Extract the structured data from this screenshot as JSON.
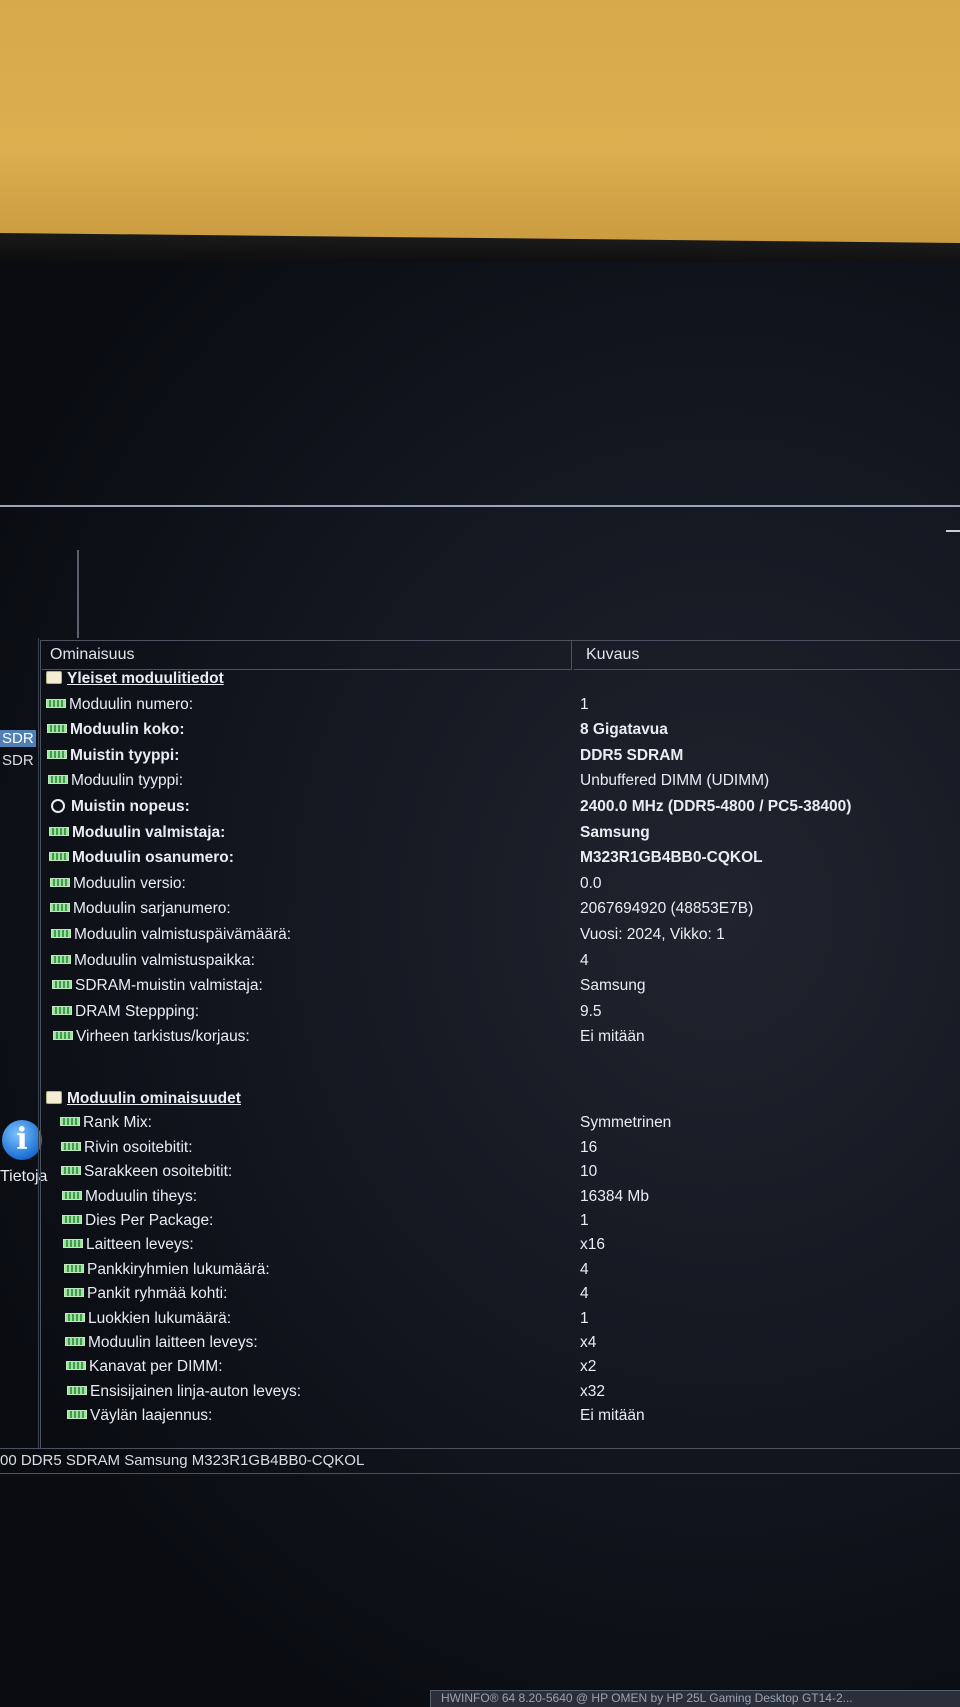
{
  "toolbar": {
    "about_label": "Tietoja"
  },
  "tree": {
    "items": [
      {
        "label": "SDR",
        "selected": true
      },
      {
        "label": "SDR",
        "selected": false
      }
    ]
  },
  "grid": {
    "columns": [
      "Ominaisuus",
      "Kuvaus"
    ],
    "sections": [
      {
        "title": "Yleiset moduulitiedot",
        "rows": [
          {
            "prop": "Moduulin numero:",
            "val": "1",
            "icon": "memory-module-icon",
            "bold": false
          },
          {
            "prop": "Moduulin koko:",
            "val": "8 Gigatavua",
            "icon": "memory-module-icon",
            "bold": true
          },
          {
            "prop": "Muistin tyyppi:",
            "val": "DDR5 SDRAM",
            "icon": "memory-module-icon",
            "bold": true
          },
          {
            "prop": "Moduulin tyyppi:",
            "val": "Unbuffered DIMM (UDIMM)",
            "icon": "memory-module-icon",
            "bold": false
          },
          {
            "prop": "Muistin nopeus:",
            "val": "2400.0 MHz (DDR5-4800 / PC5-38400)",
            "icon": "clock-icon",
            "bold": true
          },
          {
            "prop": "Moduulin valmistaja:",
            "val": "Samsung",
            "icon": "memory-module-icon",
            "bold": true
          },
          {
            "prop": "Moduulin osanumero:",
            "val": "M323R1GB4BB0-CQKOL",
            "icon": "memory-module-icon",
            "bold": true
          },
          {
            "prop": "Moduulin versio:",
            "val": "0.0",
            "icon": "memory-module-icon",
            "bold": false
          },
          {
            "prop": "Moduulin sarjanumero:",
            "val": "2067694920 (48853E7B)",
            "icon": "memory-module-icon",
            "bold": false
          },
          {
            "prop": "Moduulin valmistuspäivämäärä:",
            "val": "Vuosi: 2024, Vikko: 1",
            "icon": "memory-module-icon",
            "bold": false
          },
          {
            "prop": "Moduulin valmistuspaikka:",
            "val": "4",
            "icon": "memory-module-icon",
            "bold": false
          },
          {
            "prop": "SDRAM-muistin valmistaja:",
            "val": "Samsung",
            "icon": "memory-module-icon",
            "bold": false
          },
          {
            "prop": "DRAM Steppping:",
            "val": "9.5",
            "icon": "memory-module-icon",
            "bold": false
          },
          {
            "prop": "Virheen tarkistus/korjaus:",
            "val": "Ei mitään",
            "icon": "memory-module-icon",
            "bold": false
          }
        ]
      },
      {
        "title": "Moduulin ominaisuudet",
        "rows": [
          {
            "prop": "Rank Mix:",
            "val": "Symmetrinen",
            "icon": "memory-module-icon",
            "bold": false
          },
          {
            "prop": "Rivin osoitebitit:",
            "val": "16",
            "icon": "memory-module-icon",
            "bold": false
          },
          {
            "prop": "Sarakkeen osoitebitit:",
            "val": "10",
            "icon": "memory-module-icon",
            "bold": false
          },
          {
            "prop": "Moduulin tiheys:",
            "val": "16384 Mb",
            "icon": "memory-module-icon",
            "bold": false
          },
          {
            "prop": "Dies Per Package:",
            "val": "1",
            "icon": "memory-module-icon",
            "bold": false
          },
          {
            "prop": "Laitteen leveys:",
            "val": "x16",
            "icon": "memory-module-icon",
            "bold": false
          },
          {
            "prop": "Pankkiryhmien lukumäärä:",
            "val": "4",
            "icon": "memory-module-icon",
            "bold": false
          },
          {
            "prop": "Pankit ryhmää kohti:",
            "val": "4",
            "icon": "memory-module-icon",
            "bold": false
          },
          {
            "prop": "Luokkien lukumäärä:",
            "val": "1",
            "icon": "memory-module-icon",
            "bold": false
          },
          {
            "prop": "Moduulin laitteen leveys:",
            "val": "x4",
            "icon": "memory-module-icon",
            "bold": false
          },
          {
            "prop": "Kanavat per DIMM:",
            "val": "x2",
            "icon": "memory-module-icon",
            "bold": false
          },
          {
            "prop": "Ensisijainen linja-auton leveys:",
            "val": "x32",
            "icon": "memory-module-icon",
            "bold": false
          },
          {
            "prop": "Väylän laajennus:",
            "val": "Ei mitään",
            "icon": "memory-module-icon",
            "bold": false
          }
        ]
      }
    ]
  },
  "statusbar": {
    "text": "00 DDR5 SDRAM Samsung M323R1GB4BB0-CQKOL"
  },
  "taskbar_hint": {
    "text": "HWINFO® 64  8.20-5640 @ HP OMEN by HP 25L Gaming Desktop GT14-2..."
  }
}
